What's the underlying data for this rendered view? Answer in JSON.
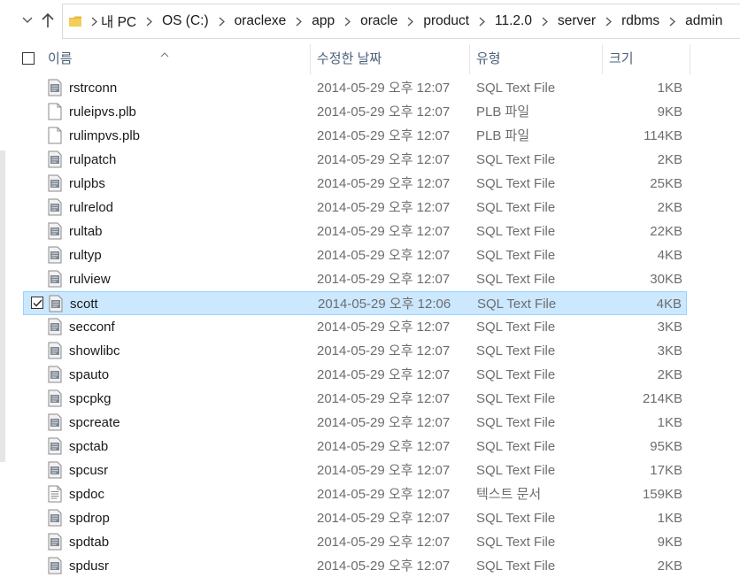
{
  "address": {
    "segments": [
      "내 PC",
      "OS (C:)",
      "oraclexe",
      "app",
      "oracle",
      "product",
      "11.2.0",
      "server",
      "rdbms",
      "admin"
    ]
  },
  "columns": {
    "name": "이름",
    "date": "수정한 날짜",
    "type": "유형",
    "size": "크기"
  },
  "colors": {
    "selection_bg": "#cce8ff",
    "selection_border": "#99d1ff",
    "header_text": "#4c607a",
    "folder": "#e8b93c"
  },
  "files": [
    {
      "name": "rstrconn",
      "date": "2014-05-29 오후 12:07",
      "type": "SQL Text File",
      "size": "1KB",
      "icon": "sql-file-icon",
      "selected": false
    },
    {
      "name": "ruleipvs.plb",
      "date": "2014-05-29 오후 12:07",
      "type": "PLB 파일",
      "size": "9KB",
      "icon": "blank-file-icon",
      "selected": false
    },
    {
      "name": "rulimpvs.plb",
      "date": "2014-05-29 오후 12:07",
      "type": "PLB 파일",
      "size": "114KB",
      "icon": "blank-file-icon",
      "selected": false
    },
    {
      "name": "rulpatch",
      "date": "2014-05-29 오후 12:07",
      "type": "SQL Text File",
      "size": "2KB",
      "icon": "sql-file-icon",
      "selected": false
    },
    {
      "name": "rulpbs",
      "date": "2014-05-29 오후 12:07",
      "type": "SQL Text File",
      "size": "25KB",
      "icon": "sql-file-icon",
      "selected": false
    },
    {
      "name": "rulrelod",
      "date": "2014-05-29 오후 12:07",
      "type": "SQL Text File",
      "size": "2KB",
      "icon": "sql-file-icon",
      "selected": false
    },
    {
      "name": "rultab",
      "date": "2014-05-29 오후 12:07",
      "type": "SQL Text File",
      "size": "22KB",
      "icon": "sql-file-icon",
      "selected": false
    },
    {
      "name": "rultyp",
      "date": "2014-05-29 오후 12:07",
      "type": "SQL Text File",
      "size": "4KB",
      "icon": "sql-file-icon",
      "selected": false
    },
    {
      "name": "rulview",
      "date": "2014-05-29 오후 12:07",
      "type": "SQL Text File",
      "size": "30KB",
      "icon": "sql-file-icon",
      "selected": false
    },
    {
      "name": "scott",
      "date": "2014-05-29 오후 12:06",
      "type": "SQL Text File",
      "size": "4KB",
      "icon": "sql-file-icon",
      "selected": true
    },
    {
      "name": "secconf",
      "date": "2014-05-29 오후 12:07",
      "type": "SQL Text File",
      "size": "3KB",
      "icon": "sql-file-icon",
      "selected": false
    },
    {
      "name": "showlibc",
      "date": "2014-05-29 오후 12:07",
      "type": "SQL Text File",
      "size": "3KB",
      "icon": "sql-file-icon",
      "selected": false
    },
    {
      "name": "spauto",
      "date": "2014-05-29 오후 12:07",
      "type": "SQL Text File",
      "size": "2KB",
      "icon": "sql-file-icon",
      "selected": false
    },
    {
      "name": "spcpkg",
      "date": "2014-05-29 오후 12:07",
      "type": "SQL Text File",
      "size": "214KB",
      "icon": "sql-file-icon",
      "selected": false
    },
    {
      "name": "spcreate",
      "date": "2014-05-29 오후 12:07",
      "type": "SQL Text File",
      "size": "1KB",
      "icon": "sql-file-icon",
      "selected": false
    },
    {
      "name": "spctab",
      "date": "2014-05-29 오후 12:07",
      "type": "SQL Text File",
      "size": "95KB",
      "icon": "sql-file-icon",
      "selected": false
    },
    {
      "name": "spcusr",
      "date": "2014-05-29 오후 12:07",
      "type": "SQL Text File",
      "size": "17KB",
      "icon": "sql-file-icon",
      "selected": false
    },
    {
      "name": "spdoc",
      "date": "2014-05-29 오후 12:07",
      "type": "텍스트 문서",
      "size": "159KB",
      "icon": "text-file-icon",
      "selected": false
    },
    {
      "name": "spdrop",
      "date": "2014-05-29 오후 12:07",
      "type": "SQL Text File",
      "size": "1KB",
      "icon": "sql-file-icon",
      "selected": false
    },
    {
      "name": "spdtab",
      "date": "2014-05-29 오후 12:07",
      "type": "SQL Text File",
      "size": "9KB",
      "icon": "sql-file-icon",
      "selected": false
    },
    {
      "name": "spdusr",
      "date": "2014-05-29 오후 12:07",
      "type": "SQL Text File",
      "size": "2KB",
      "icon": "sql-file-icon",
      "selected": false
    }
  ]
}
